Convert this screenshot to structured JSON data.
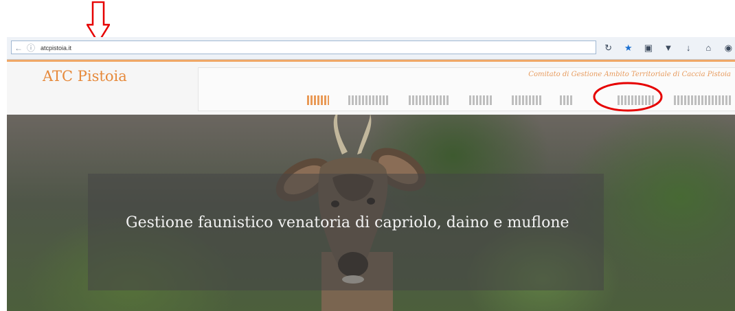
{
  "instruction_text": "",
  "browser": {
    "url": "atcpistoia.it",
    "toolbar_icons": [
      "reload-icon",
      "star-icon",
      "clipboard-icon",
      "pocket-icon",
      "download-icon",
      "home-icon",
      "menu-icon"
    ]
  },
  "site": {
    "logo": "ATC Pistoia",
    "tagline": "Comitato di Gestione Ambito Territoriale di Caccia Pistoia",
    "nav_count": 8,
    "active_nav": "HOME",
    "highlighted_nav_index": 6
  },
  "hero": {
    "title": "Gestione faunistico venatoria di capriolo, daino e muflone"
  },
  "colors": {
    "accent": "#e6893a",
    "annotation": "#e60000",
    "overlay": "rgba(70,70,70,0.55)"
  }
}
